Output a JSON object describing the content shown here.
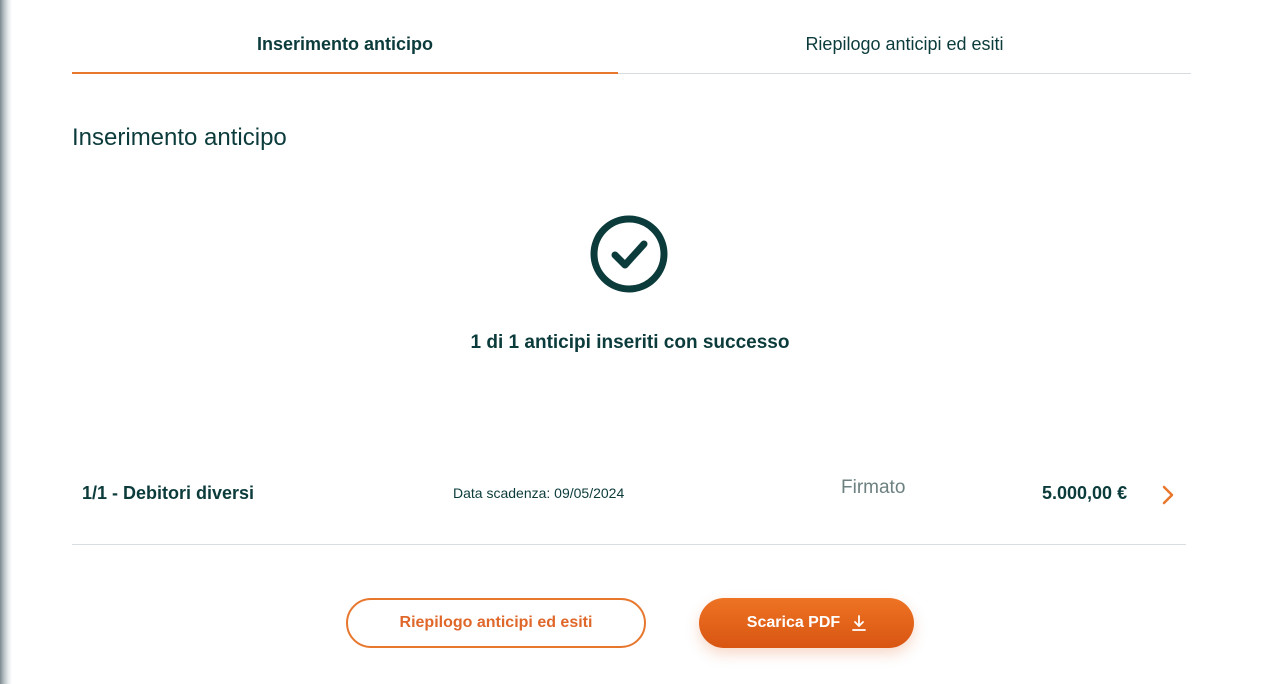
{
  "tabs": [
    {
      "label": "Inserimento anticipo",
      "active": true
    },
    {
      "label": "Riepilogo anticipi ed esiti",
      "active": false
    }
  ],
  "page_title": "Inserimento anticipo",
  "result": {
    "icon": "check-circle-icon",
    "message": "1 di 1 anticipi inseriti con successo"
  },
  "advance": {
    "title": "1/1 - Debitori diversi",
    "due_date": "Data scadenza: 09/05/2024",
    "status": "Firmato",
    "amount": "5.000,00 €",
    "icon": "chevron-right-icon"
  },
  "actions": {
    "summary_label": "Riepilogo anticipi ed esiti",
    "download_label": "Scarica PDF",
    "download_icon": "download-icon"
  },
  "colors": {
    "accent": "#e8772e",
    "text_dark": "#0c3b3b",
    "status_gray": "#6d8080",
    "divider": "#d9dddf"
  }
}
